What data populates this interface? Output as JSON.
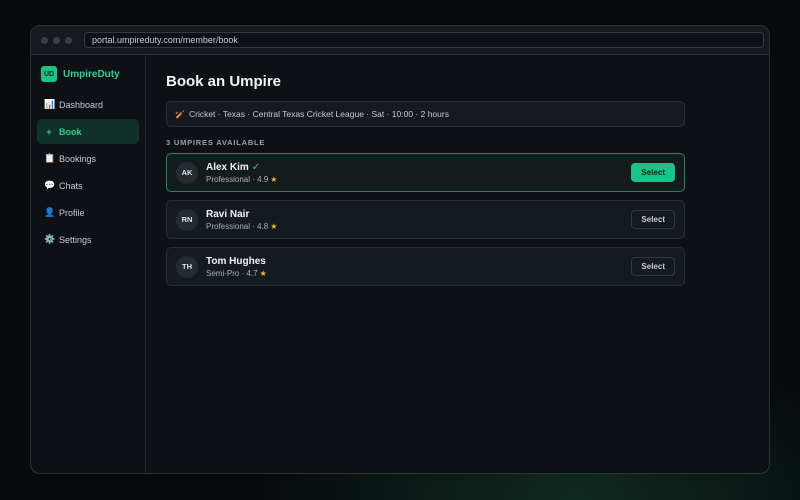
{
  "browser": {
    "url": "portal.umpireduty.com/member/book"
  },
  "brand": {
    "logo": "UD",
    "name": "UmpireDuty",
    "accent": "#18c48a"
  },
  "sidebar": {
    "items": [
      {
        "icon": "📊",
        "label": "Dashboard",
        "active": false
      },
      {
        "icon": "+",
        "label": "Book",
        "active": true
      },
      {
        "icon": "📋",
        "label": "Bookings",
        "active": false
      },
      {
        "icon": "💬",
        "label": "Chats",
        "active": false
      },
      {
        "icon": "👤",
        "label": "Profile",
        "active": false
      },
      {
        "icon": "⚙️",
        "label": "Settings",
        "active": false
      }
    ]
  },
  "main": {
    "title": "Book an Umpire",
    "context": {
      "icon": "🏏",
      "text": "Cricket · Texas · Central Texas Cricket League · Sat · 10:00 · 2 hours"
    },
    "count_label": "3 UMPIRES AVAILABLE",
    "umpires": [
      {
        "initials": "AK",
        "name": "Alex Kim",
        "verified": "✓",
        "meta": "Professional · 4.9",
        "star": "★",
        "button": "Select",
        "selected": true
      },
      {
        "initials": "RN",
        "name": "Ravi Nair",
        "verified": "",
        "meta": "Professional · 4.8",
        "star": "★",
        "button": "Select",
        "selected": false
      },
      {
        "initials": "TH",
        "name": "Tom Hughes",
        "verified": "",
        "meta": "Semi-Pro · 4.7",
        "star": "★",
        "button": "Select",
        "selected": false
      }
    ]
  }
}
